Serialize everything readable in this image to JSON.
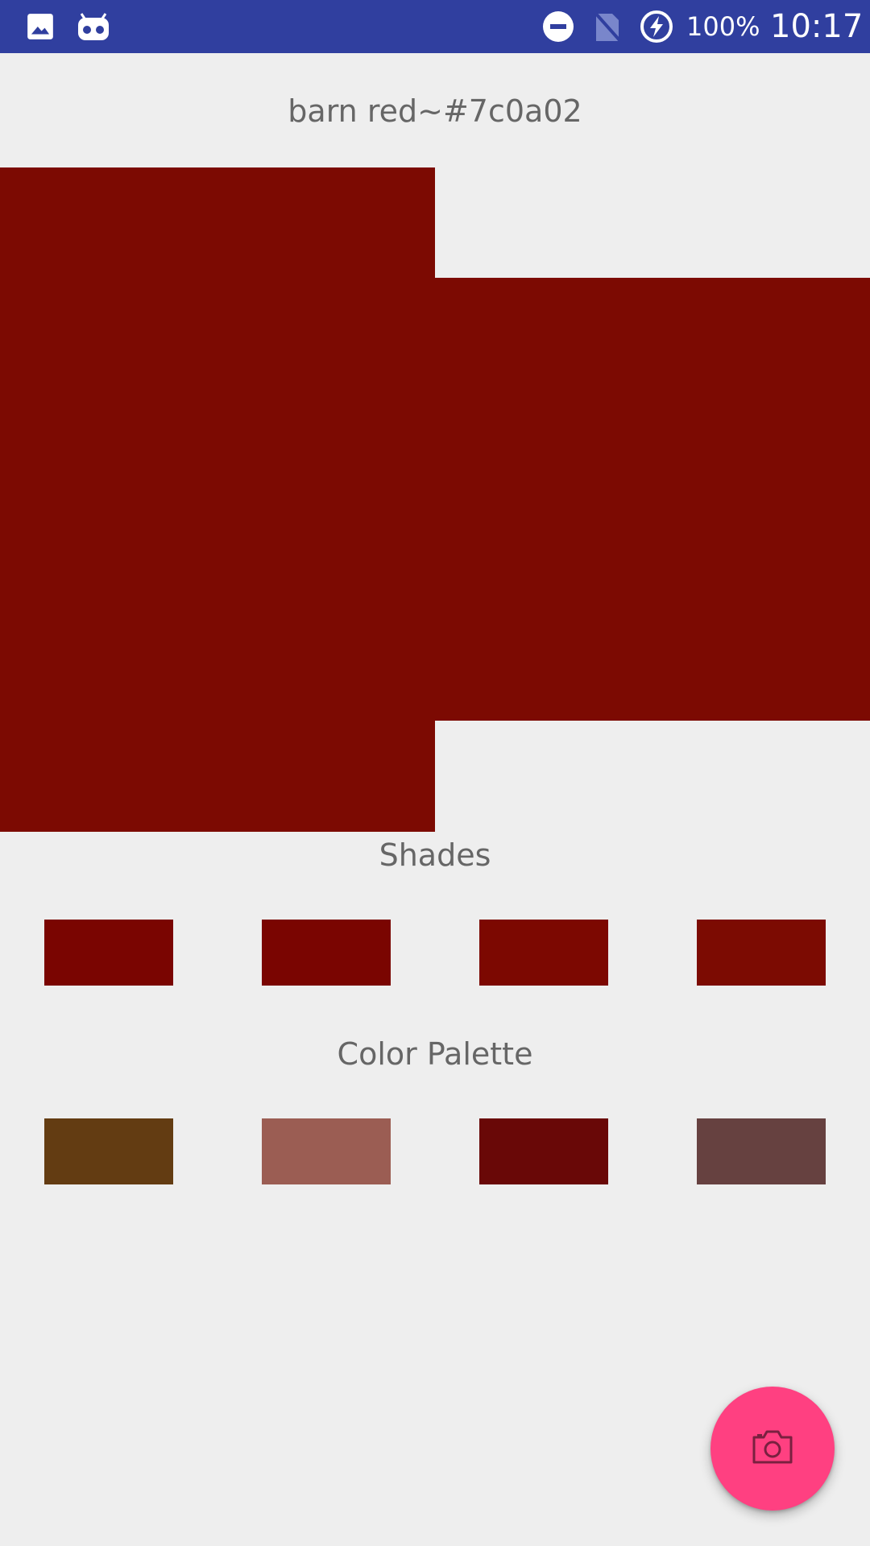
{
  "status_bar": {
    "background": "#303f9f",
    "left_icons": [
      "image-icon",
      "voicemail-robot-icon"
    ],
    "right_icons": [
      "do-not-disturb-icon",
      "no-sim-icon",
      "battery-charging-icon"
    ],
    "battery": "100%",
    "time": "10:17"
  },
  "main": {
    "title": "barn red~#7c0a02",
    "primary_color": "#7c0a02"
  },
  "shades": {
    "heading": "Shades",
    "colors": [
      "#7a0501",
      "#7a0501",
      "#7c0801",
      "#7c0b02"
    ]
  },
  "palette": {
    "heading": "Color Palette",
    "colors": [
      "#633c12",
      "#9b5d53",
      "#690807",
      "#664140"
    ]
  },
  "fab": {
    "icon": "camera-icon",
    "color": "#ff4081"
  }
}
